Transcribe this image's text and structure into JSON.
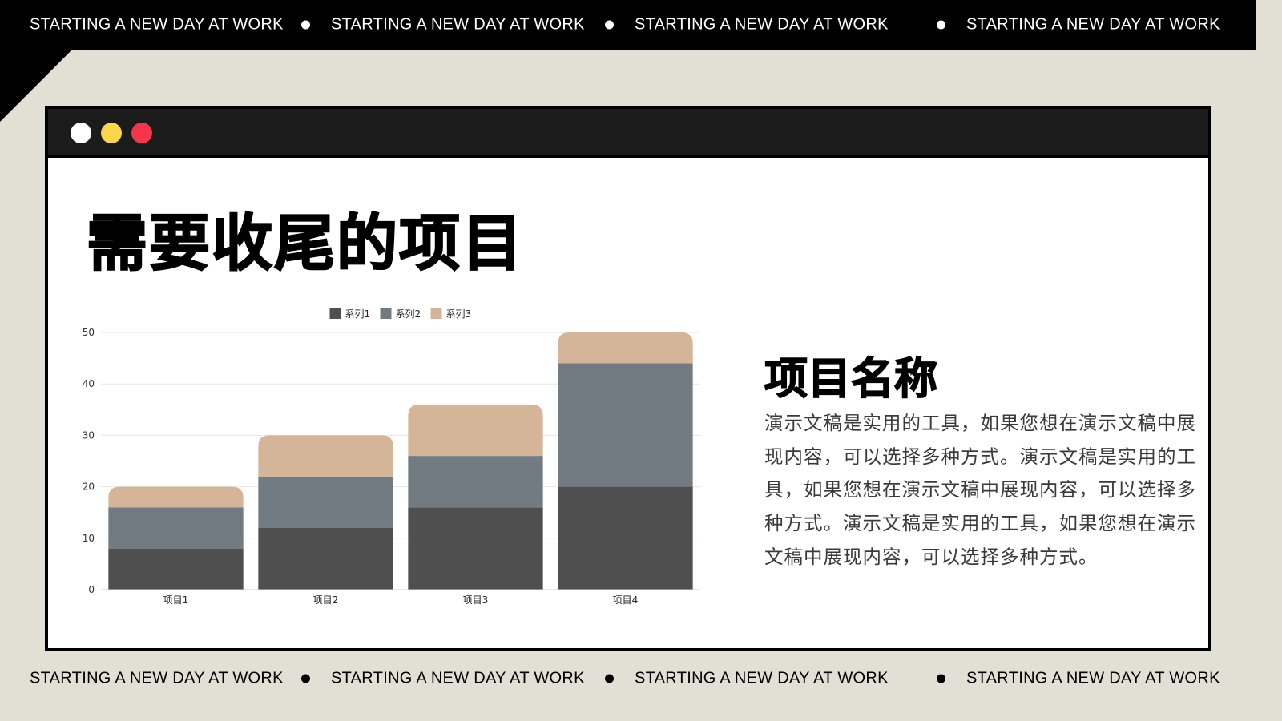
{
  "banner": {
    "text": "STARTING A NEW DAY AT WORK"
  },
  "window": {
    "lights": [
      {
        "name": "white",
        "color": "#ffffff"
      },
      {
        "name": "yellow",
        "color": "#f8d74c"
      },
      {
        "name": "red",
        "color": "#f5364a"
      }
    ]
  },
  "slide": {
    "title": "需要收尾的项目",
    "project_title": "项目名称",
    "project_body": "演示文稿是实用的工具，如果您想在演示文稿中展现内容，可以选择多种方式。演示文稿是实用的工具，如果您想在演示文稿中展现内容，可以选择多种方式。演示文稿是实用的工具，如果您想在演示文稿中展现内容，可以选择多种方式。"
  },
  "chart_data": {
    "type": "bar",
    "stacked": true,
    "categories": [
      "项目1",
      "项目2",
      "项目3",
      "项目4"
    ],
    "series": [
      {
        "name": "系列1",
        "values": [
          8,
          12,
          16,
          20
        ],
        "color": "#4f4f4f"
      },
      {
        "name": "系列2",
        "values": [
          8,
          10,
          10,
          24
        ],
        "color": "#727b82"
      },
      {
        "name": "系列3",
        "values": [
          4,
          8,
          10,
          6
        ],
        "color": "#d5b597"
      }
    ],
    "ylim": [
      0,
      50
    ],
    "yticks": [
      0,
      10,
      20,
      30,
      40,
      50
    ],
    "grid": true,
    "legend": "top"
  }
}
